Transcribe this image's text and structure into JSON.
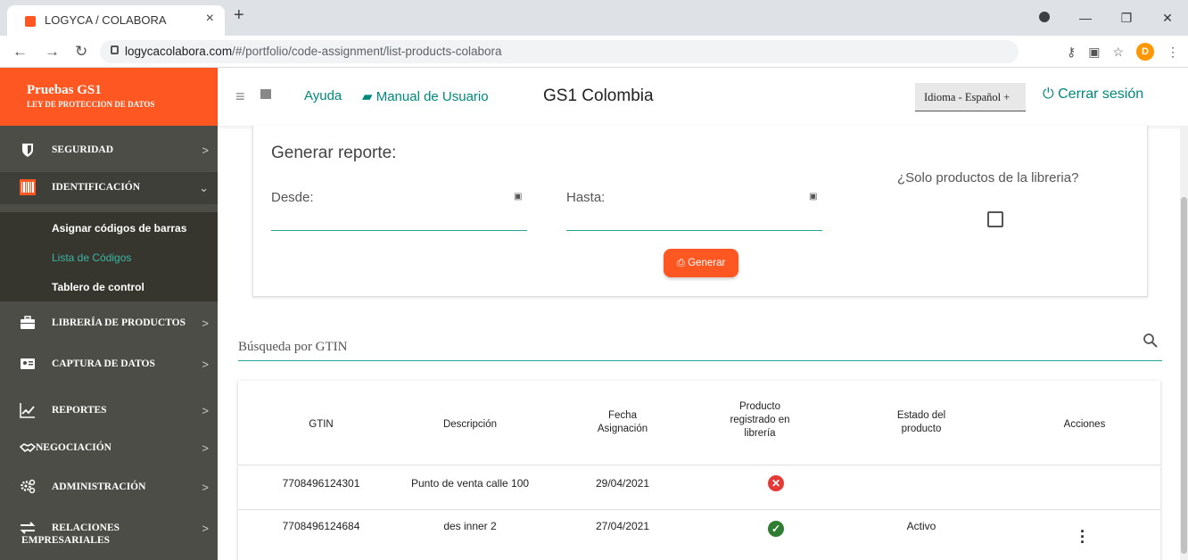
{
  "browser": {
    "tab_title": "LOGYCA / COLABORA",
    "url_host": "logycacolabora.com",
    "url_path": "/#/portfolio/code-assignment/list-products-colabora",
    "profile_initial": "D",
    "accent_color": "#ff5722"
  },
  "sidebar": {
    "brand_title": "Pruebas GS1",
    "brand_subtitle": "LEY DE PROTECCION DE DATOS",
    "items": [
      {
        "label": "SEGURIDAD",
        "icon": "shield-icon"
      },
      {
        "label": "IDENTIFICACIÓN",
        "icon": "barcode-icon"
      },
      {
        "label": "LIBRERÍA DE PRODUCTOS",
        "icon": "briefcase-icon"
      },
      {
        "label": "CAPTURA DE DATOS",
        "icon": "id-card-icon"
      },
      {
        "label": "REPORTES",
        "icon": "chart-line-icon"
      },
      {
        "label": "NEGOCIACIÓN",
        "icon": "handshake-icon"
      },
      {
        "label": "ADMINISTRACIÓN",
        "icon": "cogs-icon"
      },
      {
        "label": "RELACIONES",
        "label2": "EMPRESARIALES",
        "icon": "exchange-icon"
      }
    ],
    "submenu": [
      {
        "label": "Asignar códigos de barras"
      },
      {
        "label": "Lista de Códigos"
      },
      {
        "label": "Tablero de control"
      }
    ]
  },
  "header": {
    "ayuda": "Ayuda",
    "manual": "Manual de Usuario",
    "title": "GS1 Colombia",
    "idioma": "Idioma - Español +",
    "logout": "Cerrar sesión"
  },
  "report": {
    "title": "Generar reporte:",
    "desde_label": "Desde:",
    "hasta_label": "Hasta:",
    "solo_label": "¿Solo productos de la libreria?",
    "generate_label": "Generar"
  },
  "search": {
    "label": "Búsqueda por GTIN"
  },
  "table": {
    "headers": {
      "gtin": "GTIN",
      "descripcion": "Descripción",
      "fecha_1": "Fecha",
      "fecha_2": "Asignación",
      "prod_1": "Producto",
      "prod_2": "registrado en",
      "prod_3": "librería",
      "estado_1": "Estado del",
      "estado_2": "producto",
      "acciones": "Acciones"
    },
    "rows": [
      {
        "gtin": "7708496124301",
        "descripcion": "Punto de venta calle 100",
        "fecha": "29/04/2021",
        "registered": false,
        "estado": ""
      },
      {
        "gtin": "7708496124684",
        "descripcion": "des inner 2",
        "fecha": "27/04/2021",
        "registered": true,
        "estado": "Activo"
      }
    ]
  }
}
